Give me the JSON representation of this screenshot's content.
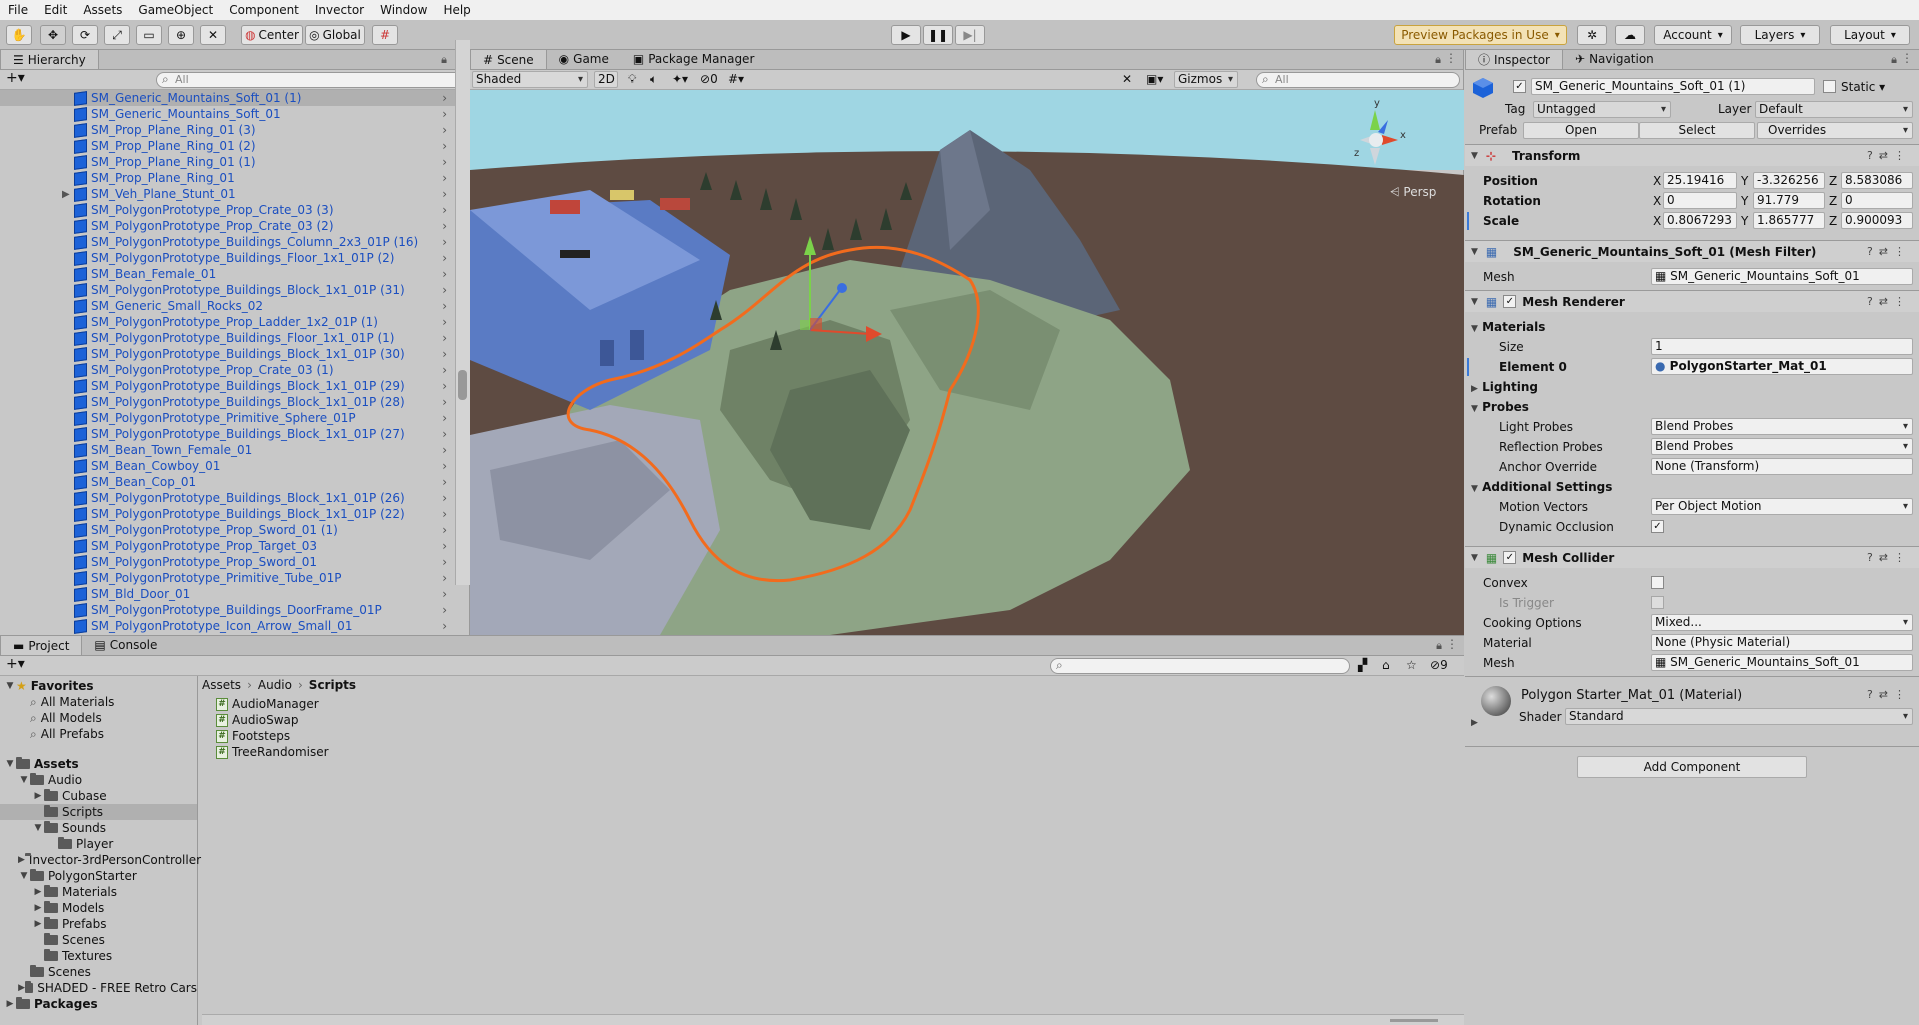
{
  "menubar": {
    "items": [
      "File",
      "Edit",
      "Assets",
      "GameObject",
      "Component",
      "Invector",
      "Window",
      "Help"
    ]
  },
  "toolbar": {
    "center_label": "Center",
    "global_label": "Global",
    "preview_packages_label": "Preview Packages in Use",
    "account_label": "Account",
    "layers_label": "Layers",
    "layout_label": "Layout"
  },
  "hierarchy": {
    "tab_label": "Hierarchy",
    "search_placeholder": "All",
    "items": [
      {
        "label": "SM_Generic_Mountains_Soft_01 (1)",
        "selected": true
      },
      {
        "label": "SM_Generic_Mountains_Soft_01"
      },
      {
        "label": "SM_Prop_Plane_Ring_01 (3)"
      },
      {
        "label": "SM_Prop_Plane_Ring_01 (2)"
      },
      {
        "label": "SM_Prop_Plane_Ring_01 (1)"
      },
      {
        "label": "SM_Prop_Plane_Ring_01"
      },
      {
        "label": "SM_Veh_Plane_Stunt_01",
        "foldable": true
      },
      {
        "label": "SM_PolygonPrototype_Prop_Crate_03 (3)"
      },
      {
        "label": "SM_PolygonPrototype_Prop_Crate_03 (2)"
      },
      {
        "label": "SM_PolygonPrototype_Buildings_Column_2x3_01P (16)"
      },
      {
        "label": "SM_PolygonPrototype_Buildings_Floor_1x1_01P (2)"
      },
      {
        "label": "SM_Bean_Female_01"
      },
      {
        "label": "SM_PolygonPrototype_Buildings_Block_1x1_01P (31)"
      },
      {
        "label": "SM_Generic_Small_Rocks_02"
      },
      {
        "label": "SM_PolygonPrototype_Prop_Ladder_1x2_01P (1)"
      },
      {
        "label": "SM_PolygonPrototype_Buildings_Floor_1x1_01P (1)"
      },
      {
        "label": "SM_PolygonPrototype_Buildings_Block_1x1_01P (30)"
      },
      {
        "label": "SM_PolygonPrototype_Prop_Crate_03 (1)"
      },
      {
        "label": "SM_PolygonPrototype_Buildings_Block_1x1_01P (29)"
      },
      {
        "label": "SM_PolygonPrototype_Buildings_Block_1x1_01P (28)"
      },
      {
        "label": "SM_PolygonPrototype_Primitive_Sphere_01P"
      },
      {
        "label": "SM_PolygonPrototype_Buildings_Block_1x1_01P (27)"
      },
      {
        "label": "SM_Bean_Town_Female_01"
      },
      {
        "label": "SM_Bean_Cowboy_01"
      },
      {
        "label": "SM_Bean_Cop_01"
      },
      {
        "label": "SM_PolygonPrototype_Buildings_Block_1x1_01P (26)"
      },
      {
        "label": "SM_PolygonPrototype_Buildings_Block_1x1_01P (22)"
      },
      {
        "label": "SM_PolygonPrototype_Prop_Sword_01 (1)"
      },
      {
        "label": "SM_PolygonPrototype_Prop_Target_03"
      },
      {
        "label": "SM_PolygonPrototype_Prop_Sword_01"
      },
      {
        "label": "SM_PolygonPrototype_Primitive_Tube_01P"
      },
      {
        "label": "SM_Bld_Door_01"
      },
      {
        "label": "SM_PolygonPrototype_Buildings_DoorFrame_01P"
      },
      {
        "label": "SM_PolygonPrototype_Icon_Arrow_Small_01"
      }
    ]
  },
  "scene": {
    "tabs": [
      "Scene",
      "Game",
      "Package Manager"
    ],
    "shading_mode": "Shaded",
    "mode_2d": "2D",
    "hidden_count": "0",
    "gizmos_label": "Gizmos",
    "search_placeholder": "All",
    "persp_label": "Persp",
    "gizmo_axes": {
      "y": "y",
      "x": "x",
      "z": "z"
    }
  },
  "inspector": {
    "tabs": [
      "Inspector",
      "Navigation"
    ],
    "object_name": "SM_Generic_Mountains_Soft_01 (1)",
    "static_label": "Static",
    "tag_label": "Tag",
    "tag_value": "Untagged",
    "layer_label": "Layer",
    "layer_value": "Default",
    "prefab_label": "Prefab",
    "prefab_open": "Open",
    "prefab_select": "Select",
    "prefab_overrides": "Overrides",
    "transform": {
      "title": "Transform",
      "position_label": "Position",
      "rotation_label": "Rotation",
      "scale_label": "Scale",
      "position": {
        "x": "25.19416",
        "y": "-3.326256",
        "z": "8.583086"
      },
      "rotation": {
        "x": "0",
        "y": "91.779",
        "z": "0"
      },
      "scale": {
        "x": "0.8067293",
        "y": "1.865777",
        "z": "0.900093"
      }
    },
    "mesh_filter": {
      "title": "SM_Generic_Mountains_Soft_01 (Mesh Filter)",
      "mesh_label": "Mesh",
      "mesh_value": "SM_Generic_Mountains_Soft_01"
    },
    "mesh_renderer": {
      "title": "Mesh Renderer",
      "materials_label": "Materials",
      "size_label": "Size",
      "size_value": "1",
      "element0_label": "Element 0",
      "element0_value": "PolygonStarter_Mat_01",
      "lighting_label": "Lighting",
      "probes_label": "Probes",
      "light_probes_label": "Light Probes",
      "light_probes_value": "Blend Probes",
      "reflection_probes_label": "Reflection Probes",
      "reflection_probes_value": "Blend Probes",
      "anchor_override_label": "Anchor Override",
      "anchor_override_value": "None (Transform)",
      "additional_settings_label": "Additional Settings",
      "motion_vectors_label": "Motion Vectors",
      "motion_vectors_value": "Per Object Motion",
      "dynamic_occlusion_label": "Dynamic Occlusion"
    },
    "mesh_collider": {
      "title": "Mesh Collider",
      "convex_label": "Convex",
      "is_trigger_label": "Is Trigger",
      "cooking_options_label": "Cooking Options",
      "cooking_options_value": "Mixed...",
      "material_label": "Material",
      "material_value": "None (Physic Material)",
      "mesh_label": "Mesh",
      "mesh_value": "SM_Generic_Mountains_Soft_01"
    },
    "material": {
      "title": "Polygon Starter_Mat_01 (Material)",
      "shader_label": "Shader",
      "shader_value": "Standard"
    },
    "add_component_label": "Add Component"
  },
  "project": {
    "tabs": [
      "Project",
      "Console"
    ],
    "hidden_count": "9",
    "breadcrumb": [
      "Assets",
      "Audio",
      "Scripts"
    ],
    "favorites_label": "Favorites",
    "favorites": [
      "All Materials",
      "All Models",
      "All Prefabs"
    ],
    "tree": [
      {
        "label": "Assets",
        "depth": 0,
        "open": true,
        "bold": true
      },
      {
        "label": "Audio",
        "depth": 1,
        "open": true
      },
      {
        "label": "Cubase",
        "depth": 2,
        "fold": true
      },
      {
        "label": "Scripts",
        "depth": 2,
        "selected": true
      },
      {
        "label": "Sounds",
        "depth": 2,
        "open": true
      },
      {
        "label": "Player",
        "depth": 3
      },
      {
        "label": "Invector-3rdPersonController",
        "depth": 1,
        "fold": true
      },
      {
        "label": "PolygonStarter",
        "depth": 1,
        "open": true
      },
      {
        "label": "Materials",
        "depth": 2,
        "fold": true
      },
      {
        "label": "Models",
        "depth": 2,
        "fold": true
      },
      {
        "label": "Prefabs",
        "depth": 2,
        "fold": true
      },
      {
        "label": "Scenes",
        "depth": 2
      },
      {
        "label": "Textures",
        "depth": 2
      },
      {
        "label": "Scenes",
        "depth": 1
      },
      {
        "label": "SHADED - FREE Retro Cars",
        "depth": 1,
        "fold": true
      },
      {
        "label": "Packages",
        "depth": 0,
        "fold": true,
        "bold": true
      }
    ],
    "files": [
      "AudioManager",
      "AudioSwap",
      "Footsteps",
      "TreeRandomiser"
    ]
  },
  "colors": {
    "accent_blue": "#1a4ec0",
    "outline_orange": "#f26b1d",
    "sky": "#9fd6e3",
    "ground": "#5e4b42",
    "terrain": "#8ea486"
  }
}
